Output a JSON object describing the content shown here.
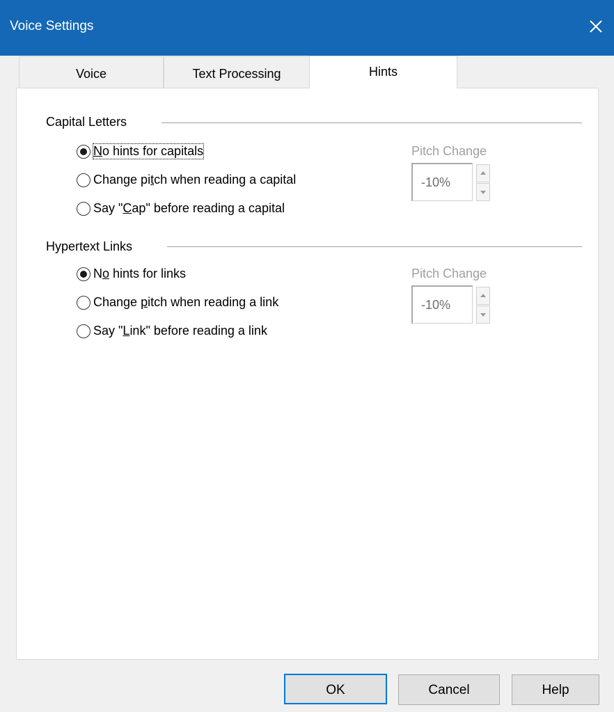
{
  "window": {
    "title": "Voice Settings",
    "close_icon": "close-icon"
  },
  "tabs": [
    {
      "label": "Voice"
    },
    {
      "label": "Text Processing"
    },
    {
      "label": "Hints",
      "active": true
    }
  ],
  "capital_letters": {
    "title": "Capital Letters",
    "options": [
      {
        "pre": "",
        "key": "N",
        "post": "o hints for capitals",
        "checked": true
      },
      {
        "pre": "Change pi",
        "key": "t",
        "post": "ch when reading a capital",
        "checked": false
      },
      {
        "pre": "Say \"",
        "key": "C",
        "post": "ap\" before reading a capital",
        "checked": false
      }
    ],
    "pitch_label": "Pitch Change",
    "pitch_value": "-10%"
  },
  "hypertext_links": {
    "title": "Hypertext Links",
    "options": [
      {
        "pre": "N",
        "key": "o",
        "post": " hints for links",
        "checked": true
      },
      {
        "pre": "Change ",
        "key": "p",
        "post": "itch when reading a link",
        "checked": false
      },
      {
        "pre": "Say \"",
        "key": "L",
        "post": "ink\" before reading a link",
        "checked": false
      }
    ],
    "pitch_label": "Pitch Change",
    "pitch_value": "-10%"
  },
  "buttons": {
    "ok": "OK",
    "cancel": "Cancel",
    "help": "Help"
  }
}
